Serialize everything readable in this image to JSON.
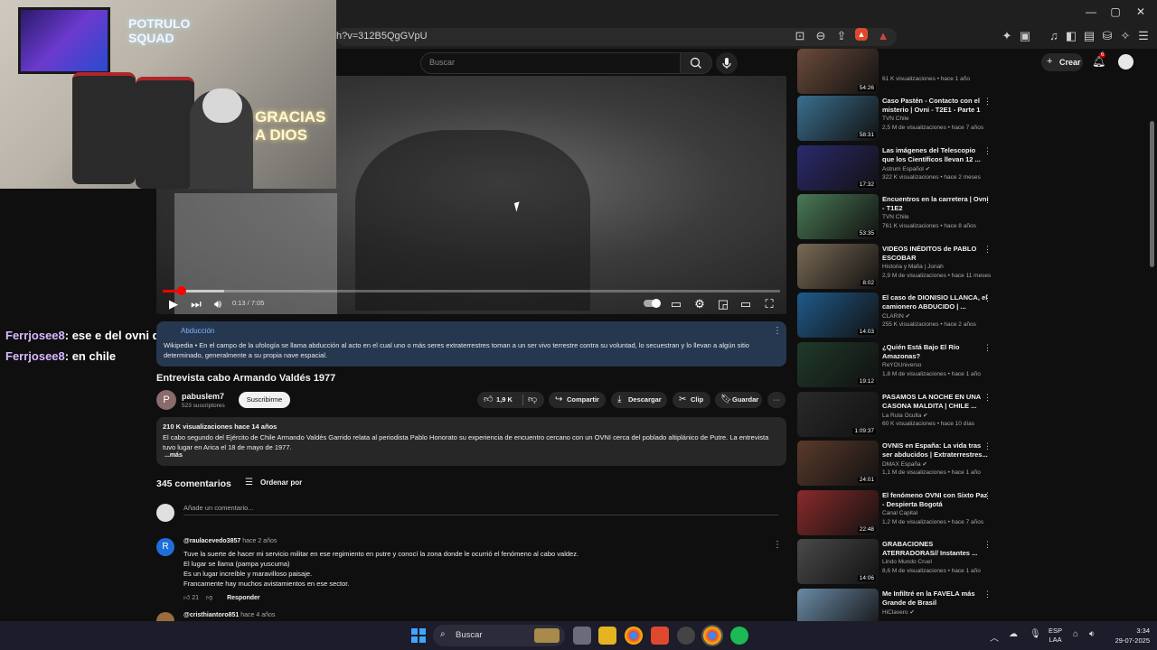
{
  "browser": {
    "url": "h?v=312B5QgGVpU",
    "window_controls": [
      "—",
      "▢",
      "✕"
    ]
  },
  "youtube_header": {
    "search_placeholder": "Buscar",
    "create_label": "Crear",
    "notification_count": "6"
  },
  "webcam_overlay": {
    "sign_text": "POTRULO SQUAD",
    "neon_text": "GRACIAS A DIOS"
  },
  "player": {
    "time": "0:13 / 7:05",
    "progress_fraction": 0.031
  },
  "chat": [
    {
      "user": "Ferrjosee8",
      "message": ": ese e del ovni que cayo"
    },
    {
      "user": "Ferrjosee8",
      "message": ": en chile"
    }
  ],
  "info_card": {
    "title": "Abducción",
    "body": "Wikipedia • En el campo de la ufología se llama abducción al acto en el cual uno o más seres extraterrestres toman a un ser vivo terrestre contra su voluntad, lo secuestran y lo llevan a algún sitio determinado, generalmente a su propia nave espacial."
  },
  "video": {
    "title": "Entrevista cabo Armando Valdés 1977",
    "channel_initial": "P",
    "channel_name": "pabuslem7",
    "subscribers": "523 suscriptores",
    "subscribe_label": "Suscribirme",
    "likes": "1,9 K",
    "share_label": "Compartir",
    "download_label": "Descargar",
    "clip_label": "Clip",
    "save_label": "Guardar",
    "more_label": "···"
  },
  "description": {
    "stats": "210 K visualizaciones  hace 14 años",
    "text": "El cabo segundo del Ejército de Chile Armando Valdés Garrido relata al periodista Pablo Honorato su experiencia de encuentro cercano con un OVNI cerca del poblado altiplánico de Putre. La entrevista tuvo lugar en Arica el 18 de mayo de 1977.",
    "more": "...más"
  },
  "comments": {
    "count_label": "345 comentarios",
    "sort_label": "Ordenar por",
    "add_placeholder": "Añade un comentario...",
    "items": [
      {
        "initial": "R",
        "author": "@raulacevedo3857",
        "time": "hace 2 años",
        "lines": [
          "Tuve la suerte de hacer mi servicio militar en ese regimiento en putre y conocí la zona donde le ocurrió el fenómeno al cabo valdez.",
          "El lugar se llama (pampa yuscuma)",
          "Es un lugar increíble y maravilloso paisaje.",
          "Francamente hay muchos avistamientos en ese sector."
        ],
        "likes": "21",
        "reply_label": "Responder"
      },
      {
        "author": "@cristhiantoro851",
        "time": "hace 4 años"
      }
    ]
  },
  "recommendations": [
    {
      "title": "",
      "channel": "",
      "meta": "61 K visualizaciones • hace 1 año",
      "duration": "54:26",
      "color": "#6b4b3a"
    },
    {
      "title": "Caso Pastén - Contacto con el misterio | Ovni - T2E1 - Parte 1",
      "channel": "TVN Chile",
      "meta": "2,5 M de visualizaciones • hace 7 años",
      "duration": "58:31",
      "color": "#3b6f8f"
    },
    {
      "title": "Las imágenes del Telescopio que los Científicos llevan 12 ...",
      "channel": "Astrum Español ✔",
      "meta": "322 K visualizaciones • hace 2 meses",
      "duration": "17:32",
      "color": "#2b2a6e"
    },
    {
      "title": "Encuentros en la carretera | Ovni - T1E2",
      "channel": "TVN Chile",
      "meta": "761 K visualizaciones • hace 8 años",
      "duration": "53:35",
      "color": "#4a7a55"
    },
    {
      "title": "VIDEOS INÉDITOS de PABLO ESCOBAR",
      "channel": "Historia y Mafia | Jonah",
      "meta": "2,9 M de visualizaciones • hace 11 meses",
      "duration": "8:02",
      "color": "#7a6a55"
    },
    {
      "title": "El caso de DIONISIO LLANCA, el camionero ABDUCIDO | ...",
      "channel": "CLARIN ✔",
      "meta": "255 K visualizaciones • hace 2 años",
      "duration": "14:03",
      "color": "#1f5a8a"
    },
    {
      "title": "¿Quién Está Bajo El Río Amazonas?",
      "channel": "ReYOUniverso",
      "meta": "1,8 M de visualizaciones • hace 1 año",
      "duration": "19:12",
      "color": "#1f3a2a"
    },
    {
      "title": "PASAMOS LA NOCHE EN UNA CASONA MALDITA | CHILE ...",
      "channel": "La Ruta Oculta ✔",
      "meta": "60 K visualizaciones • hace 10 días",
      "duration": "1:09:37",
      "color": "#2a2a2a"
    },
    {
      "title": "OVNIS en España: La vida tras ser abducidos | Extraterrestres...",
      "channel": "DMAX España ✔",
      "meta": "1,1 M de visualizaciones • hace 1 año",
      "duration": "24:01",
      "color": "#5a3a2a"
    },
    {
      "title": "El fenómeno OVNI con Sixto Paz - Despierta Bogotá",
      "channel": "Canal Capital",
      "meta": "1,2 M de visualizaciones • hace 7 años",
      "duration": "22:48",
      "color": "#8a2a2a"
    },
    {
      "title": "GRABACIONES ATERRADORAS// Instantes ...",
      "channel": "Lindo Mundo Cruel",
      "meta": "8,6 M de visualizaciones • hace 1 año",
      "duration": "14:06",
      "color": "#4a4a4a"
    },
    {
      "title": "Me Infiltré en la FAVELA más Grande de Brasil",
      "channel": "HiClavero ✔",
      "meta": "",
      "duration": "",
      "color": "#6a8aa5"
    }
  ],
  "taskbar": {
    "search_placeholder": "Buscar",
    "language": "ESP",
    "layout": "LAA",
    "time": "3:34",
    "date": "29-07-2025"
  }
}
